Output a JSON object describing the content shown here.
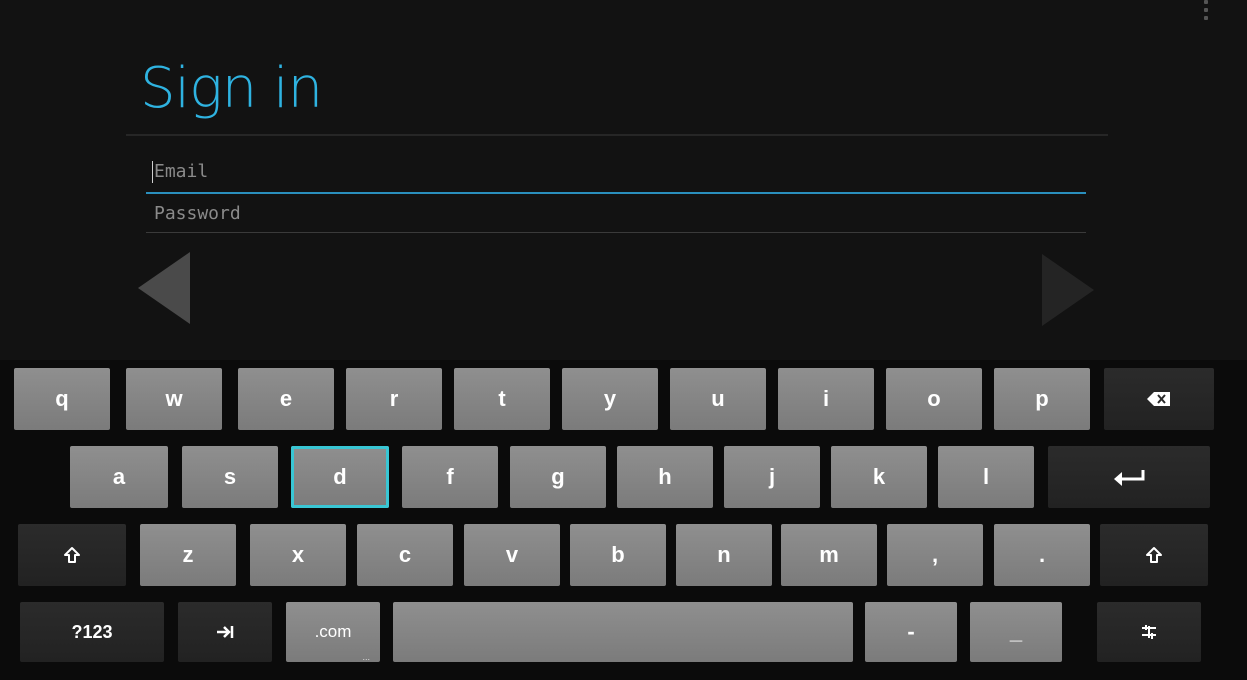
{
  "title": "Sign in",
  "email": {
    "placeholder": "Email",
    "value": ""
  },
  "password": {
    "placeholder": "Password",
    "value": ""
  },
  "keyboard": {
    "row1": [
      "q",
      "w",
      "e",
      "r",
      "t",
      "y",
      "u",
      "i",
      "o",
      "p"
    ],
    "row2": [
      "a",
      "s",
      "d",
      "f",
      "g",
      "h",
      "j",
      "k",
      "l"
    ],
    "row3": [
      "z",
      "x",
      "c",
      "v",
      "b",
      "n",
      "m",
      ",",
      "."
    ],
    "row4": {
      "symbols": "?123",
      "dotcom": ".com",
      "dotcom_sub": "...",
      "dash": "-",
      "underscore": "_"
    },
    "icons": {
      "backspace": "backspace-icon",
      "enter": "enter-icon",
      "shift": "shift-icon",
      "tab": "tab-icon",
      "settings": "keyboard-settings-icon"
    },
    "selected_key": "d"
  },
  "colors": {
    "accent": "#2fb3e1",
    "selection": "#39c6d4",
    "background": "#121212"
  }
}
